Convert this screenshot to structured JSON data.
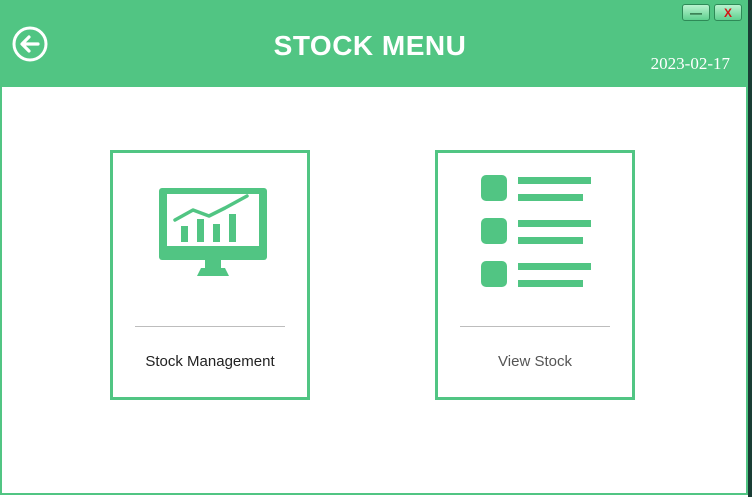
{
  "header": {
    "title": "STOCK MENU",
    "date": "2023-02-17",
    "back_icon": "arrow-left-circle-icon"
  },
  "window_controls": {
    "minimize_label": "—",
    "close_label": "X"
  },
  "cards": [
    {
      "label": "Stock Management",
      "icon": "monitor-chart-icon"
    },
    {
      "label": "View Stock",
      "icon": "list-icon"
    }
  ],
  "colors": {
    "accent": "#51c583",
    "close_text": "#d31515",
    "background": "#ffffff"
  }
}
